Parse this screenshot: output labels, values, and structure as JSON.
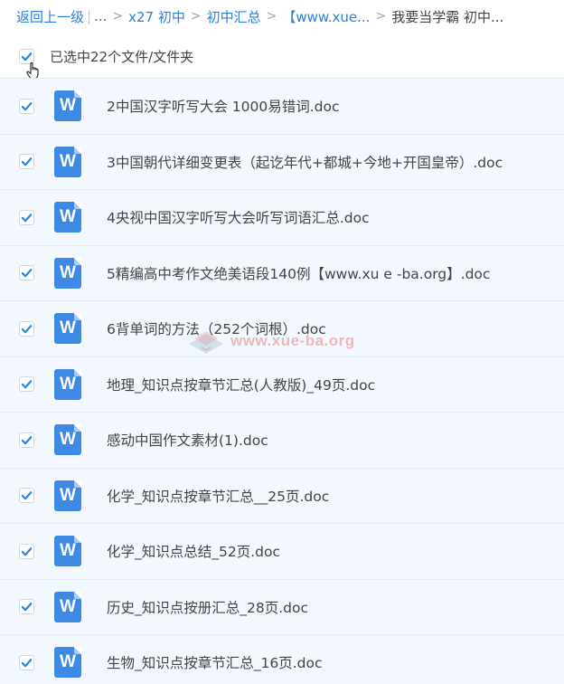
{
  "breadcrumb": {
    "back": "返回上一级",
    "ellipsis": "...",
    "items": [
      "x27 初中",
      "初中汇总",
      "【www.xue..."
    ],
    "current": "我要当学霸 初中..."
  },
  "selection": {
    "label": "已选中22个文件/文件夹",
    "checked": true
  },
  "files": [
    {
      "name": "2中国汉字听写大会 1000易错词.doc",
      "icon": "word-doc-icon",
      "checked": true
    },
    {
      "name": "3中国朝代详细变更表（起讫年代+都城+今地+开国皇帝）.doc",
      "icon": "word-doc-icon",
      "checked": true
    },
    {
      "name": "4央视中国汉字听写大会听写词语汇总.doc",
      "icon": "word-doc-icon",
      "checked": true
    },
    {
      "name": "5精编高中考作文绝美语段140例【www.xu e -ba.org】.doc",
      "icon": "word-doc-icon",
      "checked": true
    },
    {
      "name": "6背单词的方法（252个词根）.doc",
      "icon": "word-doc-icon",
      "checked": true
    },
    {
      "name": "地理_知识点按章节汇总(人教版)_49页.doc",
      "icon": "word-doc-icon",
      "checked": true
    },
    {
      "name": "感动中国作文素材(1).doc",
      "icon": "word-doc-icon",
      "checked": true
    },
    {
      "name": "化学_知识点按章节汇总__25页.doc",
      "icon": "word-doc-icon",
      "checked": true
    },
    {
      "name": "化学_知识点总结_52页.doc",
      "icon": "word-doc-icon",
      "checked": true
    },
    {
      "name": "历史_知识点按册汇总_28页.doc",
      "icon": "word-doc-icon",
      "checked": true
    },
    {
      "name": "生物_知识点按章节汇总_16页.doc",
      "icon": "word-doc-icon",
      "checked": true
    }
  ],
  "file_icon_letter": "W",
  "watermark": {
    "text": "www.xue-ba.org"
  },
  "colors": {
    "link": "#2b7fd8",
    "check": "#2e86de",
    "row_bg": "#f3f8fe",
    "doc_icon": "#3d89e3"
  }
}
